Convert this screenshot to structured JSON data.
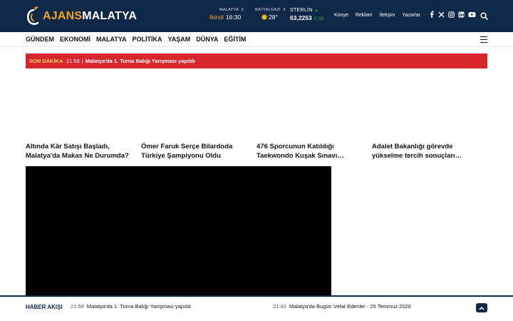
{
  "header": {
    "logo": "AJANSMALATYA",
    "city_widget": {
      "label": "MALATYA",
      "prayer_name": "İkindi",
      "prayer_time": "16:30"
    },
    "weather_widget": {
      "label": "BATTALGAZİ",
      "temperature": "28°"
    },
    "currency_widget": {
      "label": "STERLİN",
      "value": "63,2253",
      "change": "0.36"
    },
    "nav": [
      "Künye",
      "Reklam",
      "İletişim",
      "Yazarlar"
    ],
    "social_icons": [
      "facebook-icon",
      "x-icon",
      "instagram-icon",
      "linkedin-icon",
      "youtube-icon"
    ]
  },
  "menu": [
    "GÜNDEM",
    "EKONOMİ",
    "MALATYA",
    "POLİTİKA",
    "YAŞAM",
    "DÜNYA",
    "EĞİTİM"
  ],
  "breaking": {
    "tag": "SON DAKİKA",
    "time": "21:58",
    "text": "Malatya'da 1. Turna Balığı Yarışması yapıldı"
  },
  "cards": [
    {
      "title": "Altında Kâr Satışı Başladı, Malatya'da Makas Ne Durumda?"
    },
    {
      "title": "Ömer Faruk Serçe Bilardoda Türkiye Şampiyonu Oldu"
    },
    {
      "title": "476 Sporcunun Katıldığı Taekwondo Kuşak Sınavı…"
    },
    {
      "title": "Adalet Bakanlığı görevde yükselme tercih sonuçları…"
    }
  ],
  "footer": {
    "label": "HABER AKIŞI",
    "items": [
      {
        "time": "21:58",
        "text": "Malatya'da 1. Turna Balığı Yarışması yapıldı"
      },
      {
        "time": "21:43",
        "text": "Malatya'da Bugün Vefat Edenler - 25 Temmuz 2026"
      }
    ]
  },
  "colors": {
    "navy": "#0f2848",
    "accent": "#f7a51c",
    "breaking_red": "#d7262c",
    "change_green": "#2ea34a"
  }
}
